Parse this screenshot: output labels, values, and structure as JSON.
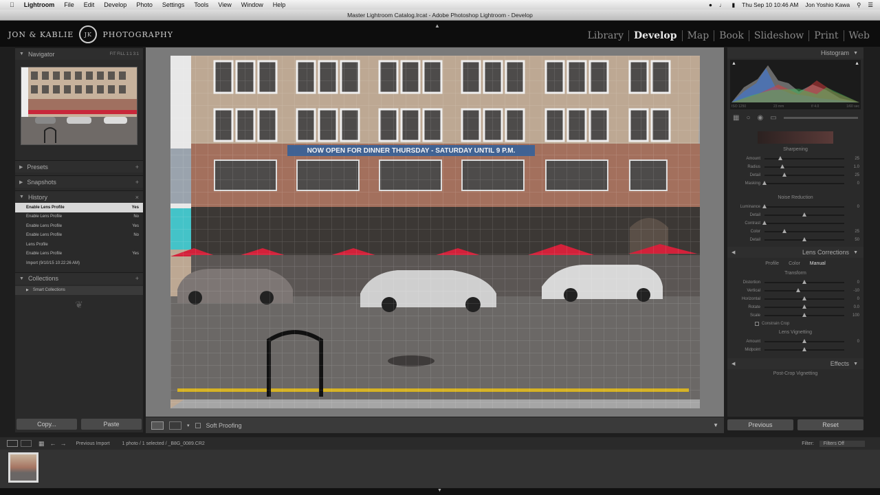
{
  "menubar": {
    "app": "Lightroom",
    "items": [
      "File",
      "Edit",
      "Develop",
      "Photo",
      "Settings",
      "Tools",
      "View",
      "Window",
      "Help"
    ],
    "clock": "Thu Sep 10  10:46 AM",
    "user": "Jon Yoshio Kawa"
  },
  "window": {
    "title": "Master Lightroom Catalog.lrcat - Adobe Photoshop Lightroom - Develop"
  },
  "identity": {
    "brand_left": "JON & KABLIE",
    "brand_right": "PHOTOGRAPHY"
  },
  "modules": [
    "Library",
    "Develop",
    "Map",
    "Book",
    "Slideshow",
    "Print",
    "Web"
  ],
  "active_module": "Develop",
  "left_panel": {
    "navigator": {
      "label": "Navigator",
      "zoom_options": "FIT  FILL  1:1  3:1"
    },
    "presets": "Presets",
    "snapshots": "Snapshots",
    "history": {
      "label": "History",
      "items": [
        {
          "label": "Enable Lens Profile",
          "value": "Yes"
        },
        {
          "label": "Enable Lens Profile",
          "value": "No"
        },
        {
          "label": "Enable Lens Profile",
          "value": "Yes"
        },
        {
          "label": "Enable Lens Profile",
          "value": "No"
        },
        {
          "label": "Lens Profile",
          "value": ""
        },
        {
          "label": "Enable Lens Profile",
          "value": "Yes"
        },
        {
          "label": "Import (9/10/15 10:22:26 AM)",
          "value": ""
        }
      ]
    },
    "collections": {
      "label": "Collections",
      "smart": "Smart Collections"
    },
    "copy_button": "Copy...",
    "paste_button": "Paste"
  },
  "photo": {
    "sign": "NOW OPEN FOR DINNER THURSDAY - SATURDAY UNTIL 9 P.M."
  },
  "toolbar": {
    "soft_proofing": "Soft Proofing"
  },
  "right_panel": {
    "histogram": "Histogram",
    "histogram_info": [
      "ISO 1250",
      "23 mm",
      "f/ 4.0",
      "1/60 sec"
    ],
    "sharpening": {
      "label": "Sharpening",
      "sliders": [
        {
          "label": "Amount",
          "value": "25",
          "pos": 0.2
        },
        {
          "label": "Radius",
          "value": "1.0",
          "pos": 0.22
        },
        {
          "label": "Detail",
          "value": "25",
          "pos": 0.25
        },
        {
          "label": "Masking",
          "value": "0",
          "pos": 0.0
        }
      ]
    },
    "noise": {
      "label": "Noise Reduction",
      "sliders": [
        {
          "label": "Luminance",
          "value": "0",
          "pos": 0.0
        },
        {
          "label": "Detail",
          "value": "",
          "pos": 0.5
        },
        {
          "label": "Contrast",
          "value": "",
          "pos": 0.0
        },
        {
          "label": "Color",
          "value": "25",
          "pos": 0.25
        },
        {
          "label": "Detail",
          "value": "50",
          "pos": 0.5
        }
      ]
    },
    "lens_corrections": {
      "label": "Lens Corrections",
      "tabs": [
        "Profile",
        "Color",
        "Manual"
      ],
      "active_tab": "Manual",
      "transform": "Transform",
      "sliders": [
        {
          "label": "Distortion",
          "value": "0",
          "pos": 0.5
        },
        {
          "label": "Vertical",
          "value": "-10",
          "pos": 0.42
        },
        {
          "label": "Horizontal",
          "value": "0",
          "pos": 0.5
        },
        {
          "label": "Rotate",
          "value": "0.0",
          "pos": 0.5
        },
        {
          "label": "Scale",
          "value": "100",
          "pos": 0.5
        }
      ],
      "constrain": "Constrain Crop",
      "lens_vignetting": "Lens Vignetting",
      "vignette_sliders": [
        {
          "label": "Amount",
          "value": "0",
          "pos": 0.5
        },
        {
          "label": "Midpoint",
          "value": "",
          "pos": 0.5
        }
      ]
    },
    "effects": "Effects",
    "post_crop": "Post-Crop Vignetting",
    "previous_button": "Previous",
    "reset_button": "Reset"
  },
  "filmstrip": {
    "source": "Previous Import",
    "info": "1 photo / 1 selected / _B8G_0089.CR2",
    "filter_label": "Filter:",
    "filter_value": "Filters Off"
  }
}
